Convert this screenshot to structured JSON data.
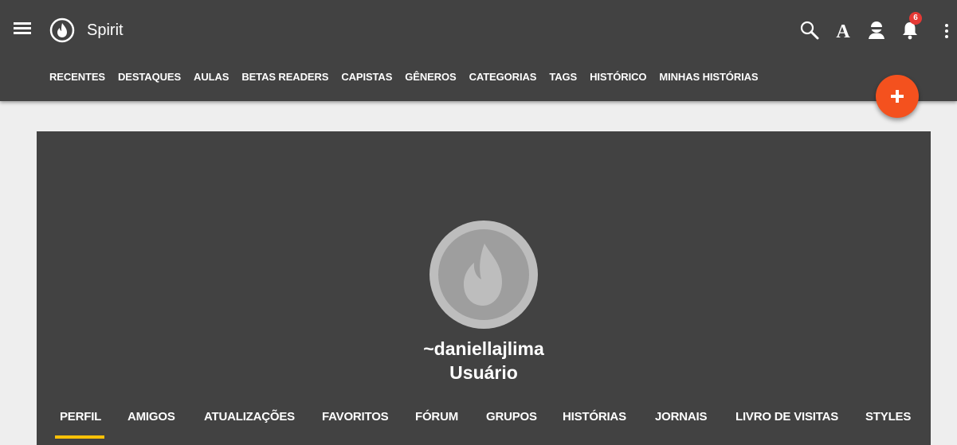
{
  "app": {
    "title": "Spirit"
  },
  "header": {
    "notification_count": "6",
    "font_icon_glyph": "A",
    "icons": [
      "menu-icon",
      "spirit-flame-logo",
      "search-icon",
      "font-size-icon",
      "user-icon",
      "bell-icon",
      "more-vert-icon"
    ]
  },
  "nav": {
    "links": [
      "RECENTES",
      "DESTAQUES",
      "AULAS",
      "BETAS READERS",
      "CAPISTAS",
      "GÊNEROS",
      "CATEGORIAS",
      "TAGS",
      "HISTÓRICO",
      "MINHAS HISTÓRIAS"
    ]
  },
  "fab": {
    "icon": "plus-icon",
    "color": "#f4511e"
  },
  "profile": {
    "username": "~daniellajlima",
    "role": "Usuário",
    "tabs": [
      "PERFIL",
      "AMIGOS",
      "ATUALIZAÇÕES",
      "FAVORITOS",
      "FÓRUM",
      "GRUPOS",
      "HISTÓRIAS",
      "JORNAIS",
      "LIVRO DE VISITAS",
      "STYLES"
    ],
    "active_tab": "PERFIL"
  },
  "colors": {
    "header_bg": "#424242",
    "page_bg": "#eeeeee",
    "active_tab_underline": "#ffc107",
    "badge": "#e53935"
  }
}
